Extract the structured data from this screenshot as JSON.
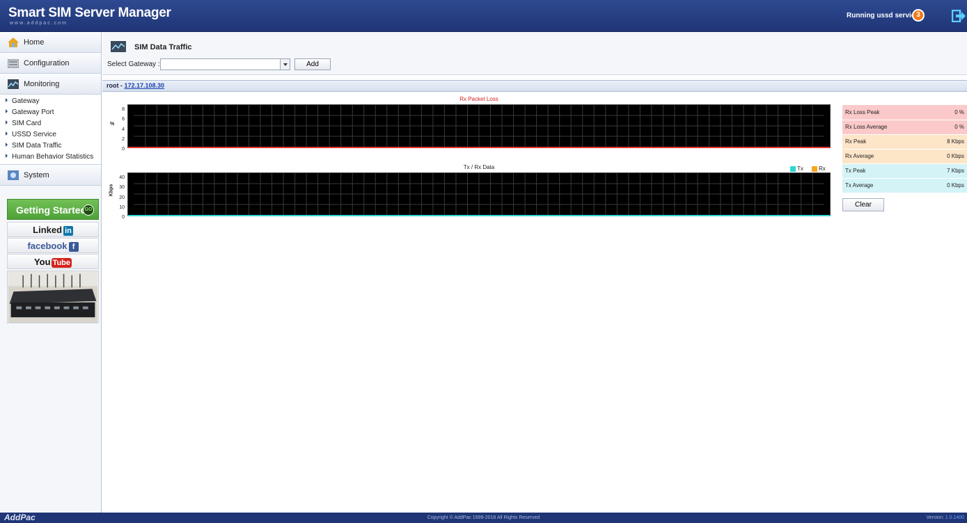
{
  "header": {
    "title": "Smart SIM Server Manager",
    "subtitle": "www.addpac.com",
    "ussd_status": "Running ussd service",
    "ussd_count": "3"
  },
  "sidebar": {
    "home": "Home",
    "configuration": "Configuration",
    "monitoring": "Monitoring",
    "monitoring_items": [
      "Gateway",
      "Gateway Port",
      "SIM Card",
      "USSD Service",
      "SIM Data Traffic",
      "Human Behavior Statistics"
    ],
    "system": "System",
    "getting_started": "Getting Started",
    "go_badge": "GO",
    "linkedin": "Linked",
    "linkedin_badge": "in",
    "facebook": "facebook",
    "facebook_badge": "f",
    "youtube": "You",
    "youtube_badge": "Tube"
  },
  "page": {
    "title": "SIM Data Traffic",
    "select_gateway_label": "Select Gateway :",
    "add_button": "Add",
    "root_prefix": "root - ",
    "root_ip": "172.17.108.30"
  },
  "chart_data": [
    {
      "type": "line",
      "title": "Rx Packet Loss",
      "ylabel": "%",
      "yticks": [
        "8",
        "6",
        "4",
        "2",
        "0"
      ],
      "ylim": [
        0,
        8
      ],
      "series": [
        {
          "values": [
            0
          ]
        }
      ]
    },
    {
      "type": "line",
      "title": "Tx / Rx Data",
      "ylabel": "Kbps",
      "yticks": [
        "40",
        "30",
        "20",
        "10",
        "0"
      ],
      "ylim": [
        0,
        40
      ],
      "legend": "top-right",
      "series": [
        {
          "name": "Tx",
          "color": "#31d5d0",
          "values": [
            0
          ]
        },
        {
          "name": "Rx",
          "color": "#f5a623",
          "values": [
            0
          ]
        }
      ]
    }
  ],
  "stats": [
    {
      "label": "Rx Loss Peak",
      "value": "0 %",
      "color": "#fbc9c9"
    },
    {
      "label": "Rx Loss Average",
      "value": "0 %",
      "color": "#fbc9c9"
    },
    {
      "label": "Rx Peak",
      "value": "8 Kbps",
      "color": "#fde5c8"
    },
    {
      "label": "Rx Average",
      "value": "0 Kbps",
      "color": "#fde5c8"
    },
    {
      "label": "Tx Peak",
      "value": "7 Kbps",
      "color": "#d4f3f7"
    },
    {
      "label": "Tx Average",
      "value": "0 Kbps",
      "color": "#d4f3f7"
    }
  ],
  "clear_button": "Clear",
  "footer": {
    "brand": "AddPac",
    "copyright": "Copyright © AddPac 1999-2018 All Rights Reserved",
    "version_label": "Version: ",
    "version": "1.0.1400"
  }
}
